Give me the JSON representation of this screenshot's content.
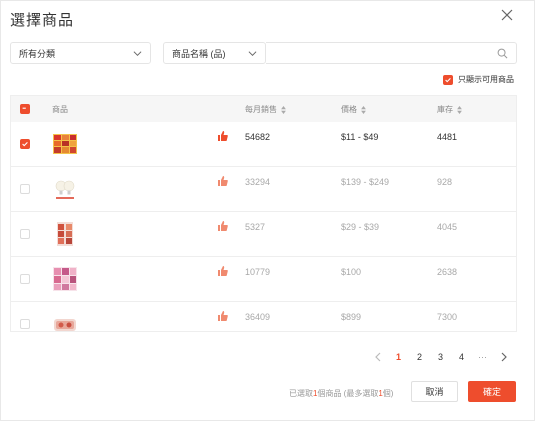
{
  "dialog": {
    "title": "選擇商品",
    "accent_color": "#ee4d2d"
  },
  "filters": {
    "category_value": "所有分類",
    "search_field_value": "商品名稱 (品)",
    "search_placeholder": "",
    "only_available_label": "只顯示可用商品",
    "only_available_checked": true
  },
  "table": {
    "headers": {
      "product": "商品",
      "monthly_sales": "每月銷售",
      "price": "價格",
      "stock": "庫存"
    },
    "rows": [
      {
        "selected": true,
        "hot": true,
        "image": "snack-pack-icon",
        "monthly_sales": "54682",
        "price": "$11 - $49",
        "stock": "4481"
      },
      {
        "selected": false,
        "hot": true,
        "image": "light-bulb-icon",
        "monthly_sales": "33294",
        "price": "$139 - $249",
        "stock": "928"
      },
      {
        "selected": false,
        "hot": true,
        "image": "snack-bag-icon",
        "monthly_sales": "5327",
        "price": "$29 - $39",
        "stock": "4045"
      },
      {
        "selected": false,
        "hot": true,
        "image": "candy-pack-icon",
        "monthly_sales": "10779",
        "price": "$100",
        "stock": "2638"
      },
      {
        "selected": false,
        "hot": true,
        "image": "gift-box-icon",
        "monthly_sales": "36409",
        "price": "$899",
        "stock": "7300"
      }
    ]
  },
  "pagination": {
    "pages": [
      "1",
      "2",
      "3",
      "4"
    ],
    "active": "1",
    "ellipsis": "···"
  },
  "footer": {
    "selected_prefix": "已選取",
    "selected_count": "1",
    "selected_mid": "個商品 (最多選取",
    "max_count": "1",
    "selected_suffix": "個)",
    "cancel_label": "取消",
    "confirm_label": "確定"
  }
}
